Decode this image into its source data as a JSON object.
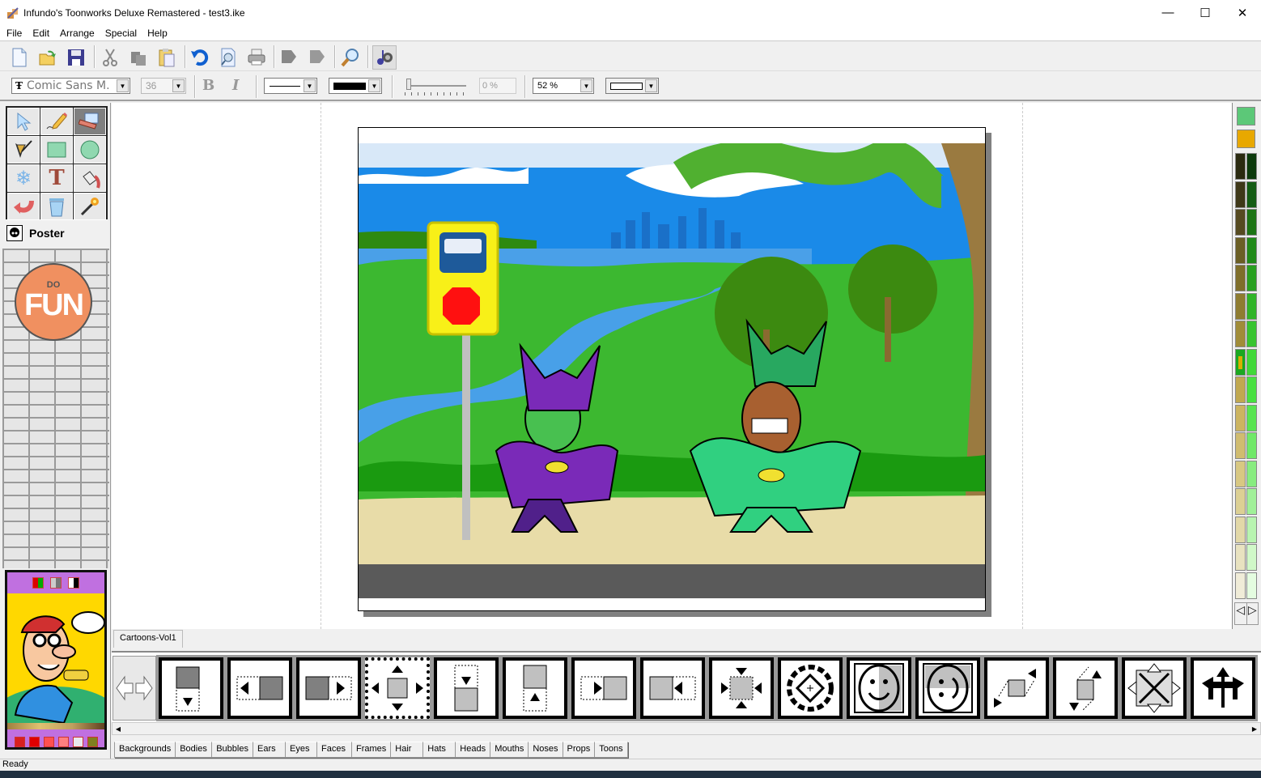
{
  "window": {
    "title": "Infundo's Toonworks Deluxe Remastered - test3.ike",
    "controls": {
      "minimize": "—",
      "maximize": "☐",
      "close": "✕"
    }
  },
  "menu": [
    "File",
    "Edit",
    "Arrange",
    "Special",
    "Help"
  ],
  "toolbar": {
    "buttons": [
      "new-icon",
      "open-icon",
      "save-icon",
      "cut-icon",
      "copy-icon",
      "paste-icon",
      "undo-icon",
      "print-preview-icon",
      "print-icon",
      "bring-forward-icon",
      "send-backward-icon",
      "zoom-icon",
      "sound-icon"
    ]
  },
  "format_bar": {
    "font": "Comic Sans M.",
    "font_icon": "Ŧ",
    "size": "36",
    "bold": "B",
    "italic": "I",
    "transparency": "0 %",
    "zoom": "52 %"
  },
  "tools": {
    "items": [
      "select-arrow-icon",
      "pencil-icon",
      "background-tool-icon",
      "pen-icon",
      "rectangle-icon",
      "ellipse-icon",
      "snowflake-icon",
      "text-tool-icon",
      "fill-bucket-icon",
      "rotate-icon",
      "trash-icon",
      "magic-wand-icon"
    ],
    "text_glyph": "T",
    "poster_label": "Poster"
  },
  "stamp": {
    "small": "DO",
    "big": "FUN"
  },
  "library": {
    "tab": "Cartoons-Vol1",
    "thumbnails": [
      "slide-down",
      "slide-left",
      "slide-right",
      "expand-all",
      "push-down",
      "push-up",
      "wipe-right",
      "wipe-left",
      "contract-all",
      "rotate-spin",
      "flip-horizontal",
      "flip-vertical",
      "skew-horizontal",
      "skew-vertical",
      "explode",
      "split-arrows"
    ]
  },
  "categories": [
    "Backgrounds",
    "Bodies",
    "Bubbles",
    "Ears",
    "Eyes",
    "Faces",
    "Frames",
    "Hair",
    "Hats",
    "Heads",
    "Mouths",
    "Noses",
    "Props",
    "Toons"
  ],
  "status": "Ready",
  "colors": {
    "current_fill": "#5cc878",
    "current_line": "#e8a800",
    "left_column": [
      "#2a2a10",
      "#3e3818",
      "#554a20",
      "#6a5e24",
      "#7e6e2a",
      "#8e7c30",
      "#a08c38",
      "#1aa820",
      "#c0a850",
      "#ccb460",
      "#d0bc70",
      "#d8c882",
      "#dcd094",
      "#e2d8a8",
      "#e8e2c0",
      "#f0ecd8"
    ],
    "right_column": [
      "#0c3a0c",
      "#145c14",
      "#1c7414",
      "#208a18",
      "#28a020",
      "#30b428",
      "#38c430",
      "#40d838",
      "#48e040",
      "#58e450",
      "#70e868",
      "#88ec80",
      "#a0f098",
      "#b8f4b0",
      "#d0f8c8",
      "#e4fce0"
    ],
    "selected_index": 7
  }
}
